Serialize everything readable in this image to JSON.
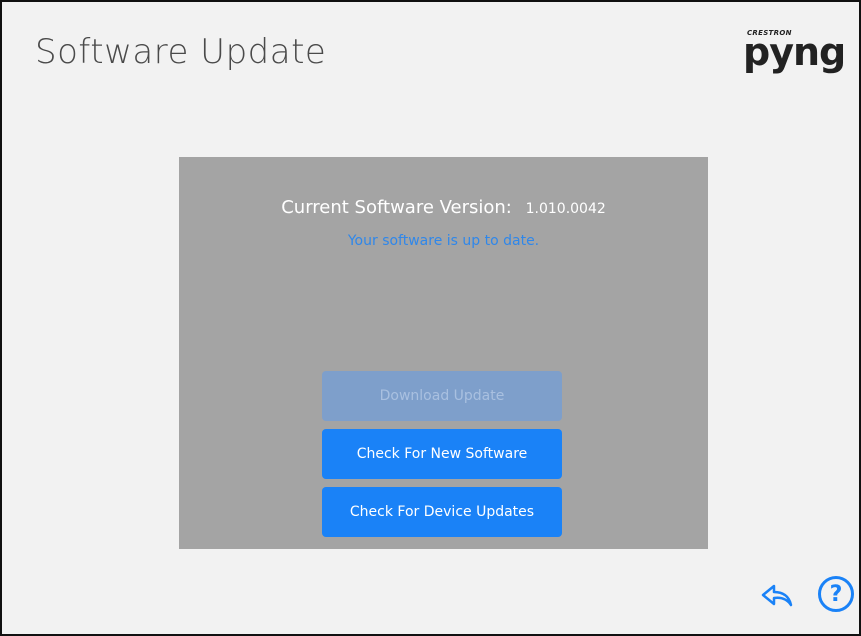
{
  "header": {
    "title": "Software Update",
    "brand_small": "CRESTRON",
    "brand_big": "pyng"
  },
  "panel": {
    "version_label": "Current Software Version:",
    "version_value": "1.010.0042",
    "status_text": "Your software is up to date."
  },
  "buttons": {
    "download": "Download Update",
    "check_software": "Check For New Software",
    "check_devices": "Check For Device Updates"
  },
  "footer": {
    "help_glyph": "?"
  },
  "colors": {
    "accent": "#1a82f7",
    "panel": "#a4a4a4",
    "background": "#f2f2f2"
  }
}
